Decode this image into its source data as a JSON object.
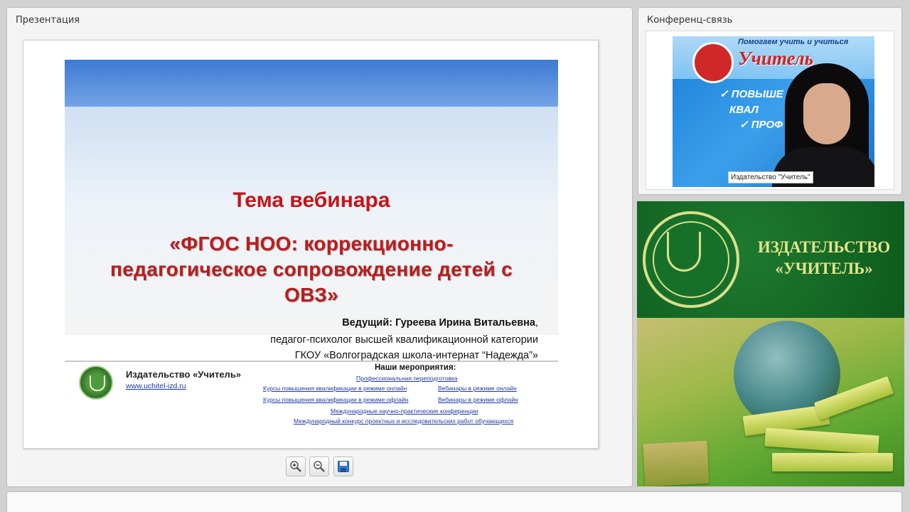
{
  "presentation_panel": {
    "title": "Презентация",
    "slide": {
      "heading": "Тема вебинара",
      "topic": "«ФГОС НОО: коррекционно-педагогическое сопровождение детей с ОВЗ»",
      "presenter_label": "Ведущий: Гуреева Ирина Витальевна",
      "presenter_comma": ",",
      "presenter_role": "педагог-психолог высшей квалификационной категории",
      "presenter_org": "ГКОУ «Волгоградская школа-интернат “Надежда”»",
      "footer": {
        "publisher": "Издательство «Учитель»",
        "url": "www.uchitel-izd.ru",
        "events_title": "Наши мероприятия:",
        "links": [
          "Профессиональная переподготовка",
          "Курсы повышения квалификации в режиме онлайн",
          "Вебинары в режиме онлайн",
          "Курсы повышения квалификации в режиме офлайн",
          "Вебинары в режиме офлайн",
          "Международные научно-практические конференции",
          "Международный конкурс проектных и исследовательских работ обучающихся"
        ]
      }
    },
    "toolbar": {
      "zoom_in": "zoom-in-icon",
      "zoom_out": "zoom-out-icon",
      "save": "save-icon"
    }
  },
  "conference_panel": {
    "title": "Конференц-связь",
    "video": {
      "banner_text": "Помогаем учить и учиться",
      "brand": "Учитель",
      "checks": [
        "ПОВЫШЕ",
        "КВАЛ",
        "ПРОФ"
      ],
      "caption": "Издательство \"Учитель\""
    }
  },
  "ad": {
    "text_line1": "ИЗДАТЕЛЬСТВО",
    "text_line2": "«УЧИТЕЛЬ»"
  },
  "colors": {
    "slide_title_red": "#c51417",
    "link_blue": "#2038a8",
    "ad_green": "#17702a",
    "ad_text": "#e3e48c"
  }
}
